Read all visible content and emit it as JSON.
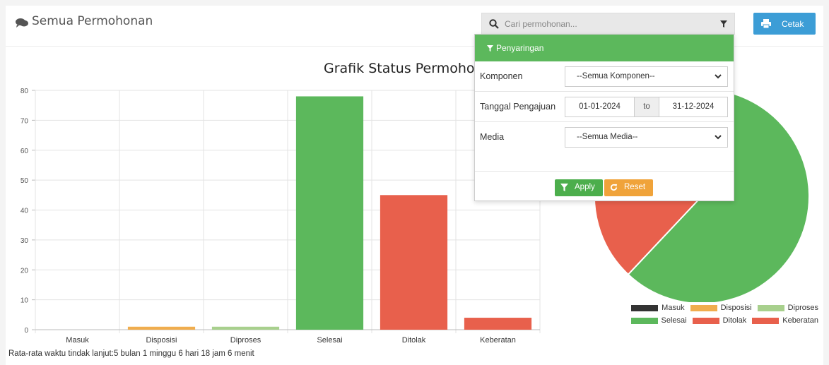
{
  "header": {
    "title": "Semua Permohonan",
    "search_placeholder": "Cari permohonan...",
    "print_label": "Cetak"
  },
  "filter": {
    "title": "Penyaringan",
    "rows": {
      "komponen_label": "Komponen",
      "komponen_value": "--Semua Komponen--",
      "tanggal_label": "Tanggal Pengajuan",
      "date_from": "01-01-2024",
      "date_sep": "to",
      "date_to": "31-12-2024",
      "media_label": "Media",
      "media_value": "--Semua Media--"
    },
    "apply_label": "Apply",
    "reset_label": "Reset"
  },
  "footer_note": "Rata-rata waktu tindak lanjut:5 bulan 1 minggu 6 hari 18 jam 6 menit",
  "chart_data": [
    {
      "type": "bar",
      "title": "Grafik Status Permohonan",
      "categories": [
        "Masuk",
        "Disposisi",
        "Diproses",
        "Selesai",
        "Ditolak",
        "Keberatan"
      ],
      "values": [
        0,
        1,
        1,
        78,
        45,
        4
      ],
      "colors": [
        "#333333",
        "#f0ad4e",
        "#a8d08d",
        "#5cb85c",
        "#e8604c",
        "#e8604c"
      ],
      "ylim": [
        0,
        80
      ],
      "yticks": [
        0,
        10,
        20,
        30,
        40,
        50,
        60,
        70,
        80
      ],
      "grid": true
    },
    {
      "type": "pie",
      "categories": [
        "Masuk",
        "Disposisi",
        "Diproses",
        "Selesai",
        "Ditolak",
        "Keberatan"
      ],
      "values": [
        0,
        1,
        1,
        78,
        45,
        4
      ],
      "colors": [
        "#333333",
        "#f0ad4e",
        "#a8d08d",
        "#5cb85c",
        "#e8604c",
        "#e8604c"
      ],
      "legend_position": "bottom-right"
    }
  ]
}
